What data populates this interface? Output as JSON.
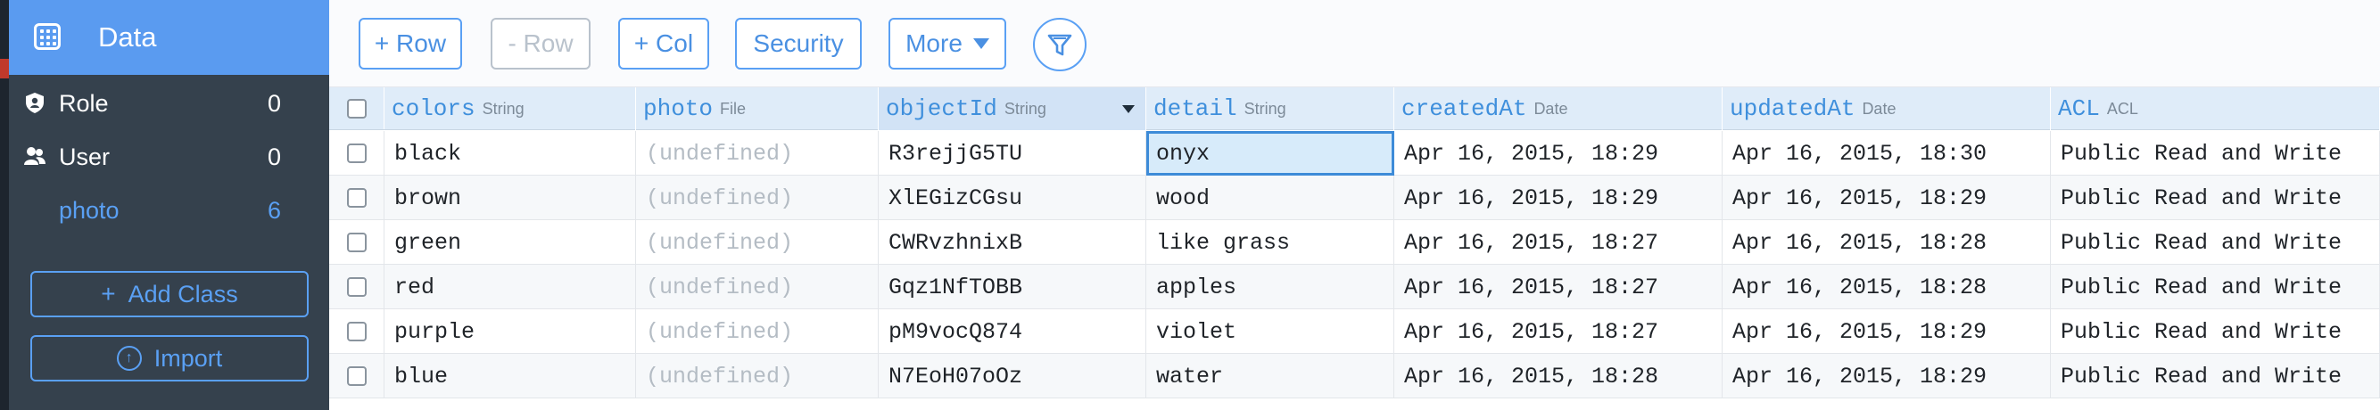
{
  "sidebar": {
    "title": "Data",
    "items": [
      {
        "label": "Role",
        "count": "0"
      },
      {
        "label": "User",
        "count": "0"
      },
      {
        "label": "photo",
        "count": "6"
      }
    ],
    "add_class_label": "Add Class",
    "import_label": "Import",
    "accent_color": "#5a9bf0"
  },
  "toolbar": {
    "add_row": "+ Row",
    "remove_row": "- Row",
    "add_col": "+ Col",
    "security": "Security",
    "more": "More"
  },
  "table": {
    "columns": [
      {
        "name": "colors",
        "type": "String"
      },
      {
        "name": "photo",
        "type": "File"
      },
      {
        "name": "objectId",
        "type": "String"
      },
      {
        "name": "detail",
        "type": "String"
      },
      {
        "name": "createdAt",
        "type": "Date"
      },
      {
        "name": "updatedAt",
        "type": "Date"
      },
      {
        "name": "ACL",
        "type": "ACL"
      }
    ],
    "rows": [
      [
        "black",
        "(undefined)",
        "R3rejjG5TU",
        "onyx",
        "Apr 16, 2015, 18:29",
        "Apr 16, 2015, 18:30",
        "Public Read and Write"
      ],
      [
        "brown",
        "(undefined)",
        "XlEGizCGsu",
        "wood",
        "Apr 16, 2015, 18:29",
        "Apr 16, 2015, 18:29",
        "Public Read and Write"
      ],
      [
        "green",
        "(undefined)",
        "CWRvzhnixB",
        "like grass",
        "Apr 16, 2015, 18:27",
        "Apr 16, 2015, 18:28",
        "Public Read and Write"
      ],
      [
        "red",
        "(undefined)",
        "Gqz1NfTOBB",
        "apples",
        "Apr 16, 2015, 18:27",
        "Apr 16, 2015, 18:28",
        "Public Read and Write"
      ],
      [
        "purple",
        "(undefined)",
        "pM9vocQ874",
        "violet",
        "Apr 16, 2015, 18:27",
        "Apr 16, 2015, 18:29",
        "Public Read and Write"
      ],
      [
        "blue",
        "(undefined)",
        "N7EoH07oOz",
        "water",
        "Apr 16, 2015, 18:28",
        "Apr 16, 2015, 18:29",
        "Public Read and Write"
      ]
    ]
  }
}
